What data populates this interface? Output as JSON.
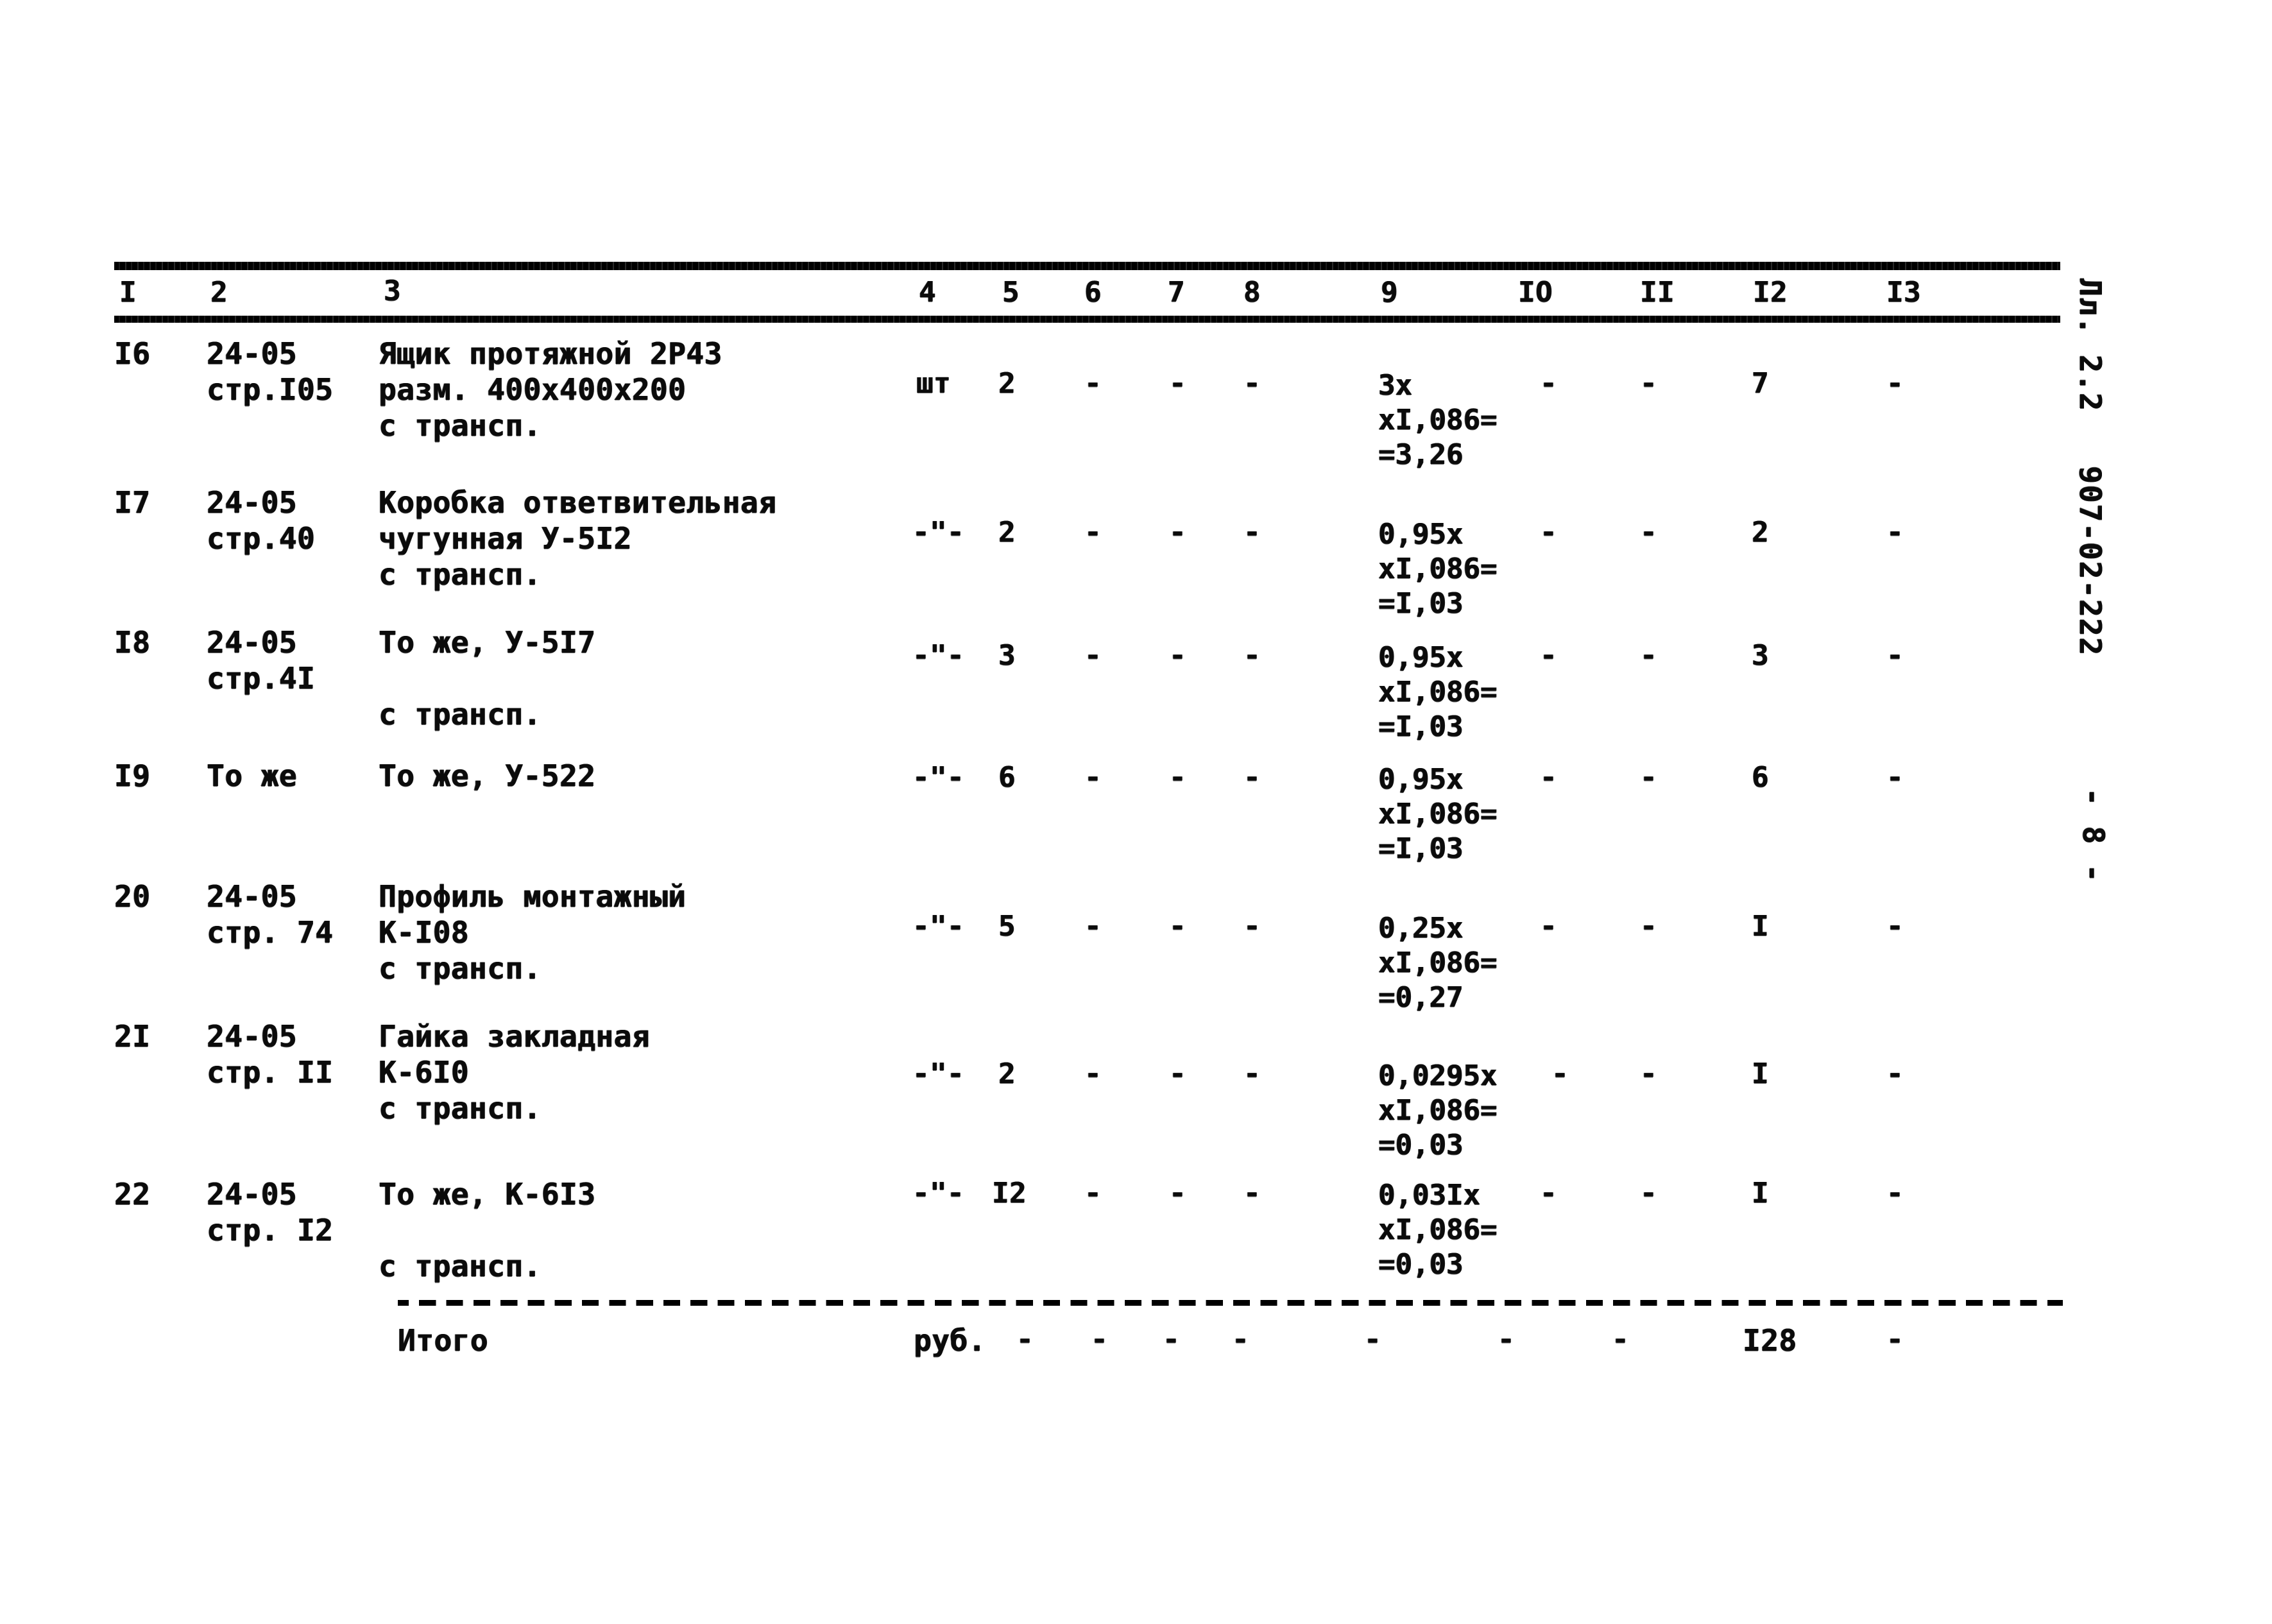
{
  "document": {
    "sheet_label": "Лл. 2.2",
    "drawing_code": "907-02-222",
    "page_number": "- 8 -"
  },
  "table": {
    "column_headers": [
      "I",
      "2",
      "3",
      "4",
      "5",
      "6",
      "7",
      "8",
      "9",
      "IO",
      "II",
      "I2",
      "I3"
    ],
    "rows": [
      {
        "num": "I6",
        "code_line1": "24-05",
        "code_line2": "стр.I05",
        "code_line3": "",
        "desc_line1": "Ящик протяжной 2Р43",
        "desc_line2": "разм. 400х400х200",
        "desc_line3": "с трансп.",
        "c4": "шт",
        "c5": "2",
        "c6": "-",
        "c7": "-",
        "c8": "-",
        "c9a": "3х",
        "c9b": "хI,086=",
        "c9c": "=3,26",
        "c10": "-",
        "c11": "-",
        "c12": "7",
        "c13": "-"
      },
      {
        "num": "I7",
        "code_line1": "24-05",
        "code_line2": "стр.40",
        "code_line3": "",
        "desc_line1": "Коробка ответвительная",
        "desc_line2": "чугунная У-5I2",
        "desc_line3": "с трансп.",
        "c4": "-\"-",
        "c5": "2",
        "c6": "-",
        "c7": "-",
        "c8": "-",
        "c9a": "0,95х",
        "c9b": "хI,086=",
        "c9c": "=I,03",
        "c10": "-",
        "c11": "-",
        "c12": "2",
        "c13": "-"
      },
      {
        "num": "I8",
        "code_line1": "24-05",
        "code_line2": "стр.4I",
        "code_line3": "",
        "desc_line1": "То же, У-5I7",
        "desc_line2": "",
        "desc_line3": "с трансп.",
        "c4": "-\"-",
        "c5": "3",
        "c6": "-",
        "c7": "-",
        "c8": "-",
        "c9a": "0,95х",
        "c9b": "хI,086=",
        "c9c": "=I,03",
        "c10": "-",
        "c11": "-",
        "c12": "3",
        "c13": "-"
      },
      {
        "num": "I9",
        "code_line1": "То же",
        "code_line2": "",
        "code_line3": "",
        "desc_line1": "То же, У-522",
        "desc_line2": "",
        "desc_line3": "",
        "c4": "-\"-",
        "c5": "6",
        "c6": "-",
        "c7": "-",
        "c8": "-",
        "c9a": "0,95х",
        "c9b": "хI,086=",
        "c9c": "=I,03",
        "c10": "-",
        "c11": "-",
        "c12": "6",
        "c13": "-"
      },
      {
        "num": "20",
        "code_line1": "24-05",
        "code_line2": "стр. 74",
        "code_line3": "",
        "desc_line1": "Профиль монтажный",
        "desc_line2": "К-I08",
        "desc_line3": "с трансп.",
        "c4": "-\"-",
        "c5": "5",
        "c6": "-",
        "c7": "-",
        "c8": "-",
        "c9a": "0,25х",
        "c9b": "хI,086=",
        "c9c": "=0,27",
        "c10": "-",
        "c11": "-",
        "c12": "I",
        "c13": "-"
      },
      {
        "num": "2I",
        "code_line1": "24-05",
        "code_line2": "стр. II",
        "code_line3": "",
        "desc_line1": "Гайка закладная",
        "desc_line2": "К-6I0",
        "desc_line3": "с трансп.",
        "c4": "-\"-",
        "c5": "2",
        "c6": "-",
        "c7": "-",
        "c8": "-",
        "c9a": "0,0295х",
        "c9b": "хI,086=",
        "c9c": "=0,03",
        "c10": "-",
        "c11": "-",
        "c12": "I",
        "c13": "-"
      },
      {
        "num": "22",
        "code_line1": "24-05",
        "code_line2": "стр. I2",
        "code_line3": "",
        "desc_line1": "То же, К-6I3",
        "desc_line2": "",
        "desc_line3": "с трансп.",
        "c4": "-\"-",
        "c5": "I2",
        "c6": "-",
        "c7": "-",
        "c8": "-",
        "c9a": "0,03Iх",
        "c9b": "хI,086=",
        "c9c": "=0,03",
        "c10": "-",
        "c11": "-",
        "c12": "I",
        "c13": "-"
      }
    ],
    "total_row": {
      "label": "Итого",
      "c4": "руб.",
      "c4b": "-",
      "c5": "-",
      "c6": "-",
      "c7": "-",
      "c8": "-",
      "c9": "-",
      "c10": "-",
      "c11": "-",
      "c12": "I28",
      "c13": "-"
    }
  }
}
